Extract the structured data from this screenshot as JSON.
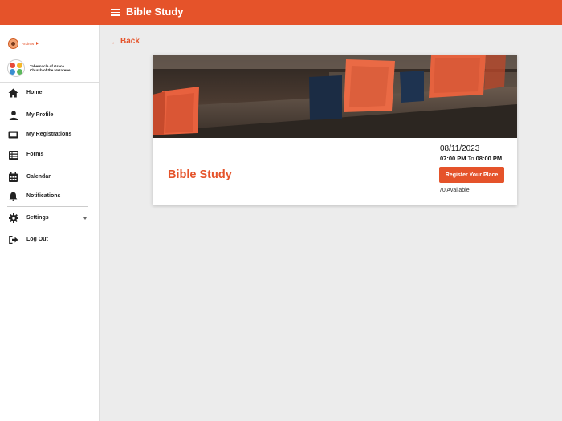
{
  "header": {
    "title": "Bible Study",
    "menu_icon": "hamburger-icon"
  },
  "sidebar": {
    "user_name": "Andrew",
    "org_name_line1": "Tabernacle of Grace",
    "org_name_line2": "Church of the Nazarene",
    "items": [
      {
        "label": "Home",
        "icon": "home-icon"
      },
      {
        "label": "My Profile",
        "icon": "person-icon"
      },
      {
        "label": "My Registrations",
        "icon": "ticket-icon"
      },
      {
        "label": "Forms",
        "icon": "list-icon"
      },
      {
        "label": "Calendar",
        "icon": "calendar-icon"
      },
      {
        "label": "Notifications",
        "icon": "bell-icon"
      },
      {
        "label": "Settings",
        "icon": "gear-icon"
      },
      {
        "label": "Log Out",
        "icon": "logout-icon"
      }
    ]
  },
  "main": {
    "back_label": "Back",
    "event": {
      "title": "Bible Study",
      "date": "08/11/2023",
      "start_time": "07:00 PM",
      "to_label": "To",
      "end_time": "08:00 PM",
      "register_label": "Register Your Place",
      "available_text": "70 Available"
    }
  },
  "colors": {
    "accent": "#e5532a",
    "background": "#ececec",
    "sidebar": "#ffffff"
  }
}
